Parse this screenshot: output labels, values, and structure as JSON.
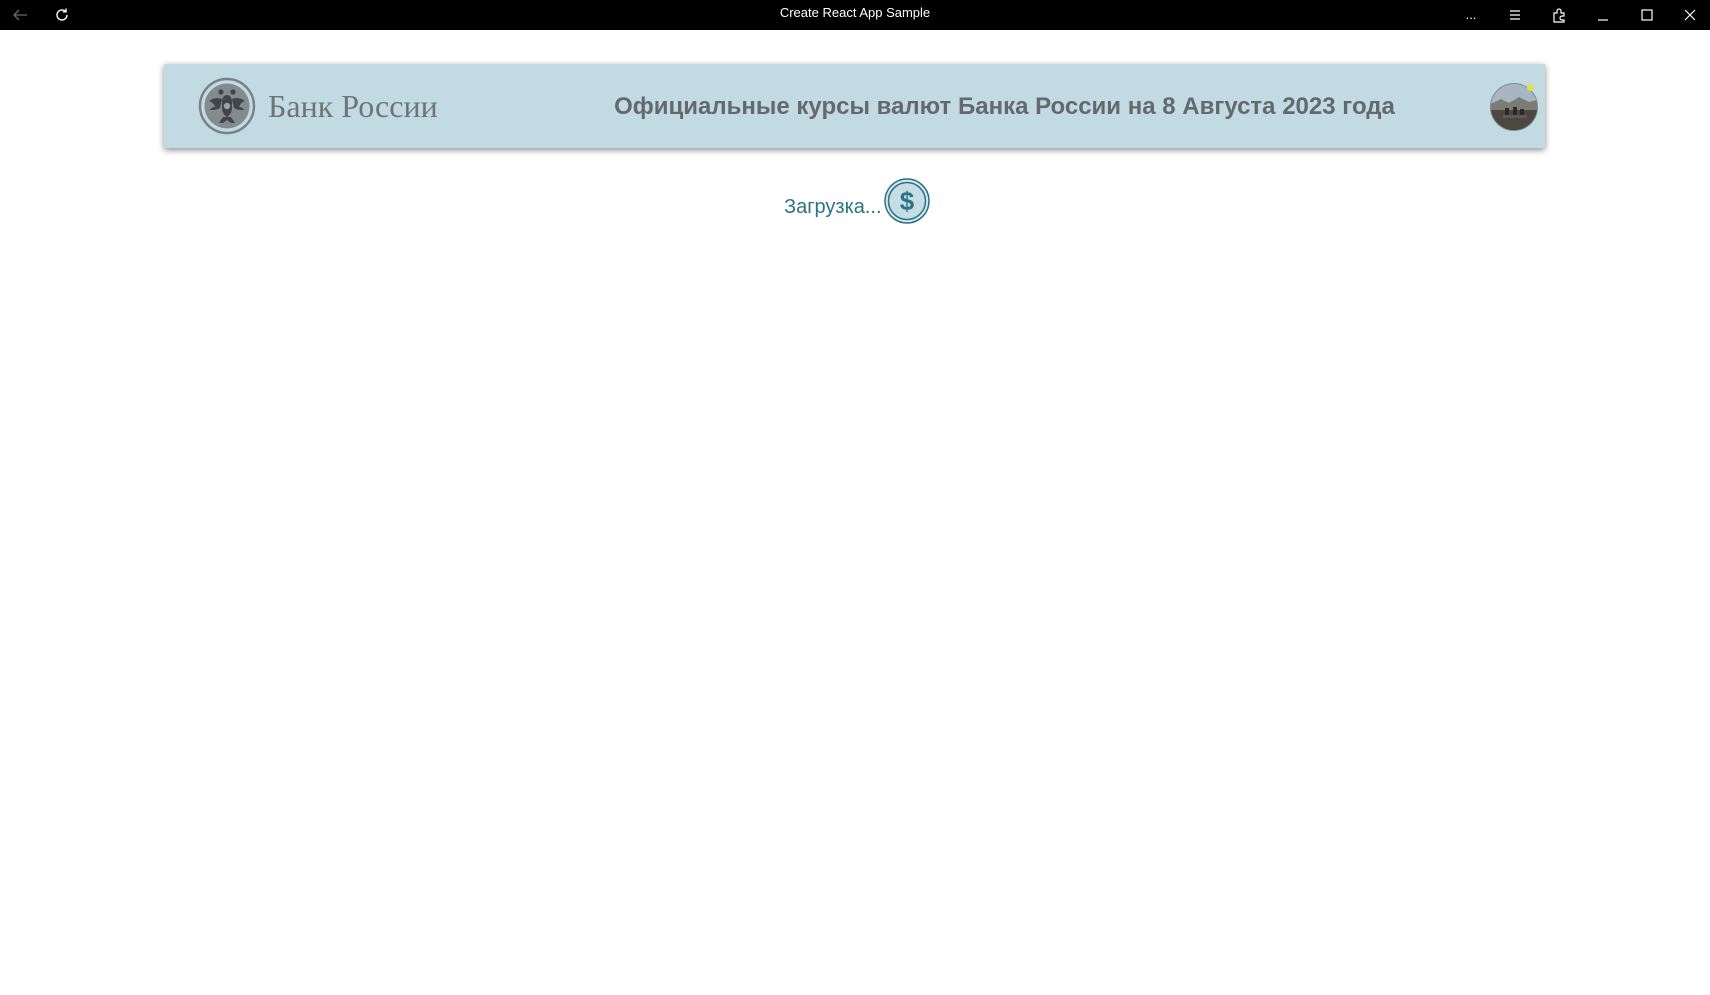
{
  "window": {
    "title": "Create React App Sample",
    "more_label": "...",
    "back_icon": "arrow-left-icon",
    "refresh_icon": "refresh-icon",
    "hamburger_icon": "hamburger-menu-icon",
    "extensions_icon": "extensions-icon",
    "minimize_icon": "minimize-icon",
    "maximize_icon": "maximize-icon",
    "close_icon": "close-icon"
  },
  "header": {
    "logo_text": "Банк России",
    "title": "Официальные курсы валют Банка России на 8 Августа 2023 года",
    "background_color": "#c2dbe2",
    "text_color": "#626a6e"
  },
  "loader": {
    "text": "Загрузка...",
    "icon": "dollar-coin-icon",
    "color": "#2a7386"
  }
}
